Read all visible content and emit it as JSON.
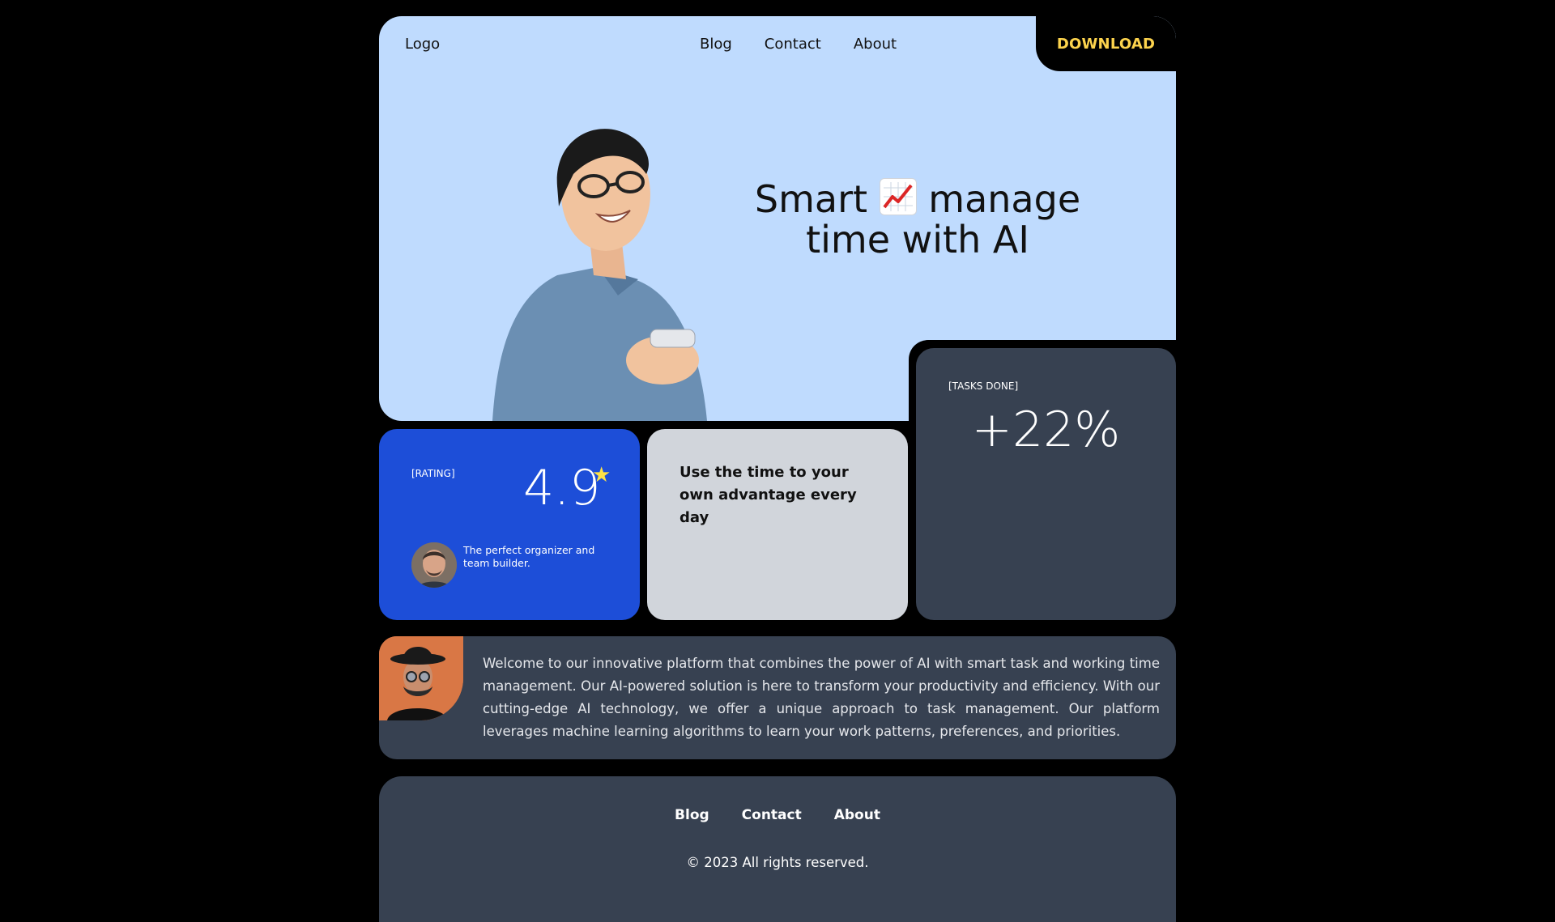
{
  "header": {
    "logo": "Logo",
    "nav": [
      "Blog",
      "Contact",
      "About"
    ],
    "download_label": "DOWNLOAD"
  },
  "hero": {
    "title_part1": "Smart",
    "title_icon": "chart-increasing-icon",
    "title_part2": "manage",
    "title_line2": "time with AI"
  },
  "rating_card": {
    "label": "[RATING]",
    "value": "4.9",
    "star_icon": "star-icon",
    "testimonial": "The perfect organizer and team builder."
  },
  "advantage_card": {
    "text": "Use the time to your own advantage every day"
  },
  "tasks_card": {
    "label": "[TASKS DONE]",
    "value": "+22%"
  },
  "about": {
    "text": "Welcome to our innovative platform that combines the power of AI with smart task and working time management. Our AI-powered solution is here to transform your productivity and efficiency. With our cutting-edge AI technology, we offer a unique approach to task management. Our platform leverages machine learning algorithms to learn your work patterns, preferences, and priorities."
  },
  "footer": {
    "nav": [
      "Blog",
      "Contact",
      "About"
    ],
    "copyright": "© 2023 All rights reserved."
  },
  "colors": {
    "hero_bg": "#bfdbfe",
    "accent_blue": "#1d4ed8",
    "card_gray": "#d1d5db",
    "slate": "#374151",
    "download_text": "#fcd34d",
    "star": "#fde047"
  }
}
